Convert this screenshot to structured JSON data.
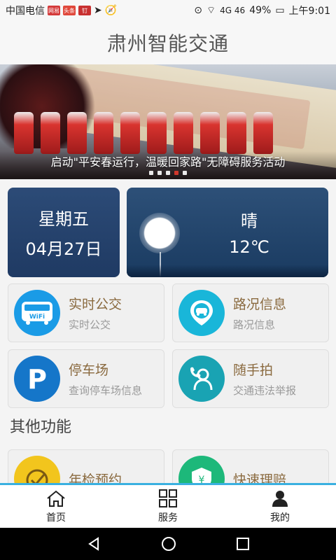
{
  "statusbar": {
    "carrier": "中国电信",
    "badge1": "网易",
    "badge2": "头条",
    "badge3": "钉",
    "network": "4G 46",
    "battery": "49%",
    "time": "上午9:01"
  },
  "app": {
    "title": "肃州智能交通"
  },
  "banner": {
    "caption": "启动\"平安春运行，温暖回家路\"无障碍服务活动",
    "dots": 5,
    "active_dot": 3
  },
  "date_card": {
    "weekday": "星期五",
    "date": "04月27日"
  },
  "weather_card": {
    "condition": "晴",
    "temperature": "12℃"
  },
  "tiles": {
    "bus": {
      "title": "实时公交",
      "subtitle": "实时公交",
      "icon": "bus-wifi-icon",
      "color": "#1a9be6"
    },
    "road": {
      "title": "路况信息",
      "subtitle": "路况信息",
      "icon": "car-location-icon",
      "color": "#19b6d9"
    },
    "parking": {
      "title": "停车场",
      "subtitle": "查询停车场信息",
      "icon": "parking-icon",
      "color": "#1576c9"
    },
    "snap": {
      "title": "随手拍",
      "subtitle": "交通违法举报",
      "icon": "phone-person-icon",
      "color": "#19a3b3"
    },
    "inspection": {
      "title": "年检预约",
      "icon": "inspection-check-icon",
      "color": "#f2c51d"
    },
    "claims": {
      "title": "快速理赔",
      "icon": "insurance-shield-icon",
      "color": "#1db87a"
    }
  },
  "section": {
    "other_functions": "其他功能"
  },
  "bottom_nav": {
    "home": "首页",
    "services": "服务",
    "mine": "我的",
    "accent": "#3ab0e0"
  }
}
